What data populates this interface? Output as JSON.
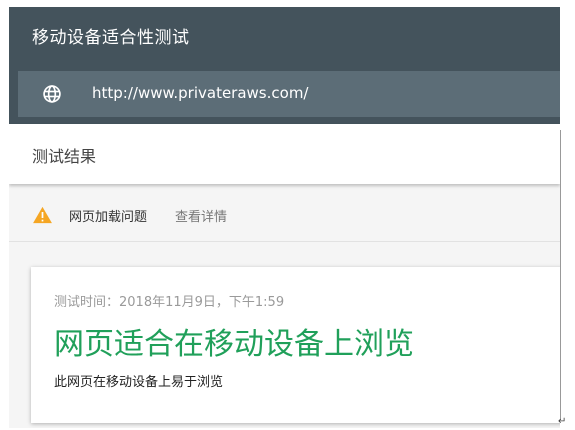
{
  "header": {
    "title": "移动设备适合性测试",
    "url": "http://www.privateraws.com/"
  },
  "results": {
    "label": "测试结果"
  },
  "issue": {
    "label": "网页加载问题",
    "link": "查看详情",
    "color": "#f5a623"
  },
  "card": {
    "test_time": "测试时间：2018年11月9日，下午1:59",
    "verdict": "网页适合在移动设备上浏览",
    "verdict_color": "#20a05a",
    "subtitle": "此网页在移动设备上易于浏览"
  },
  "icons": {
    "url": "globe-icon",
    "issue": "warning-icon"
  },
  "colors": {
    "header_bg": "#44535c",
    "url_bar_bg": "#5c6d77"
  }
}
